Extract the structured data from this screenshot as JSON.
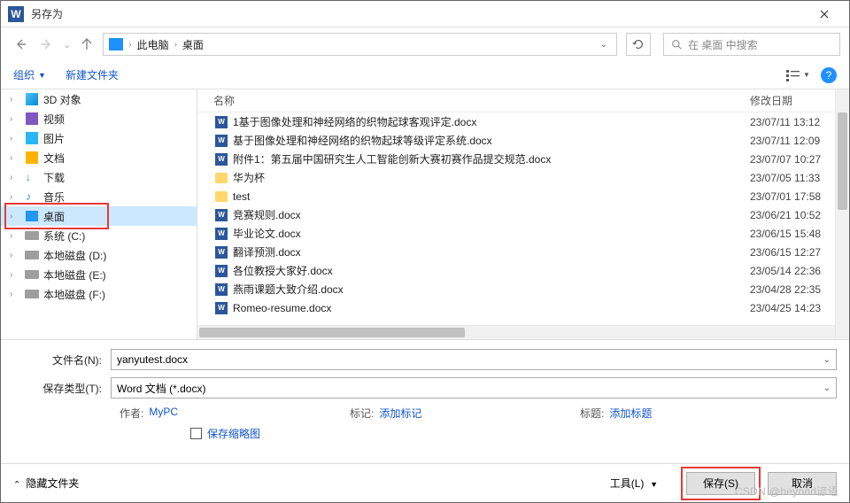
{
  "title": "另存为",
  "breadcrumb": {
    "root": "此电脑",
    "current": "桌面"
  },
  "search_placeholder": "在 桌面 中搜索",
  "toolbar": {
    "organize": "组织",
    "new_folder": "新建文件夹"
  },
  "columns": {
    "name": "名称",
    "date": "修改日期"
  },
  "tree": [
    {
      "label": "3D 对象",
      "icon": "cube3d",
      "expandable": true
    },
    {
      "label": "视频",
      "icon": "vidic",
      "expandable": true
    },
    {
      "label": "图片",
      "icon": "picic",
      "expandable": true
    },
    {
      "label": "文档",
      "icon": "docic",
      "expandable": true
    },
    {
      "label": "下载",
      "icon": "dlic",
      "expandable": true
    },
    {
      "label": "音乐",
      "icon": "music",
      "expandable": true
    },
    {
      "label": "桌面",
      "icon": "deskic",
      "expandable": true,
      "selected": true
    },
    {
      "label": "系统 (C:)",
      "icon": "diskic",
      "expandable": true
    },
    {
      "label": "本地磁盘 (D:)",
      "icon": "diskic",
      "expandable": true
    },
    {
      "label": "本地磁盘 (E:)",
      "icon": "diskic",
      "expandable": true
    },
    {
      "label": "本地磁盘 (F:)",
      "icon": "diskic",
      "expandable": true
    }
  ],
  "files": [
    {
      "name": "1基于图像处理和神经网络的织物起球客观评定.docx",
      "date": "23/07/11 13:12",
      "type": "word"
    },
    {
      "name": "基于图像处理和神经网络的织物起球等级评定系统.docx",
      "date": "23/07/11 12:09",
      "type": "word"
    },
    {
      "name": "附件1：第五届中国研究生人工智能创新大赛初赛作品提交规范.docx",
      "date": "23/07/07 10:27",
      "type": "word"
    },
    {
      "name": "华为杯",
      "date": "23/07/05 11:33",
      "type": "folder"
    },
    {
      "name": "test",
      "date": "23/07/01 17:58",
      "type": "folder"
    },
    {
      "name": "竞赛规则.docx",
      "date": "23/06/21 10:52",
      "type": "word"
    },
    {
      "name": "毕业论文.docx",
      "date": "23/06/15 15:48",
      "type": "word"
    },
    {
      "name": "翻译预测.docx",
      "date": "23/06/15 12:27",
      "type": "word"
    },
    {
      "name": "各位教授大家好.docx",
      "date": "23/05/14 22:36",
      "type": "word"
    },
    {
      "name": "燕雨课题大致介绍.docx",
      "date": "23/04/28 22:35",
      "type": "word"
    },
    {
      "name": "Romeo-resume.docx",
      "date": "23/04/25 14:23",
      "type": "word"
    }
  ],
  "form": {
    "filename_label": "文件名(N):",
    "filename_value": "yanyutest.docx",
    "filetype_label": "保存类型(T):",
    "filetype_value": "Word 文档 (*.docx)"
  },
  "meta": {
    "author_label": "作者:",
    "author_value": "MyPC",
    "tag_label": "标记:",
    "tag_value": "添加标记",
    "title_label": "标题:",
    "title_value": "添加标题",
    "save_thumbnail": "保存缩略图"
  },
  "footer": {
    "hide_folders": "隐藏文件夹",
    "tools": "工具(L)",
    "save": "保存(S)",
    "cancel": "取消"
  },
  "watermark": "CSDN @beyond谚语"
}
